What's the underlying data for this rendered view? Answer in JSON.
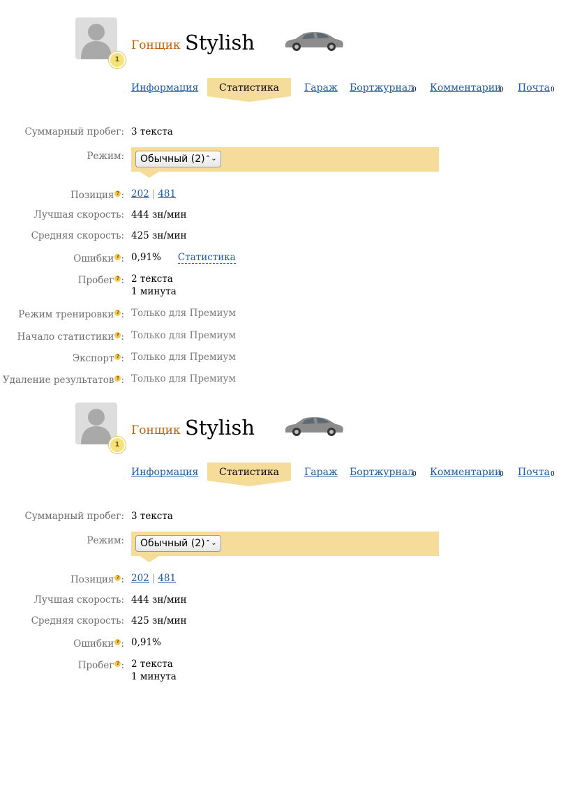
{
  "profile": {
    "rank": "Гонщик",
    "nickname": "Stylish",
    "level": "1"
  },
  "tabs": {
    "info": "Информация",
    "stats": "Статистика",
    "garage": "Гараж",
    "journal": "Бортжурнал",
    "journal_count": "0",
    "comments": "Комментарии",
    "comments_count": "0",
    "mail": "Почта",
    "mail_count": "0"
  },
  "stats": {
    "total_label": "Суммарный пробег:",
    "total_value": "3 текста",
    "mode_label": "Режим:",
    "mode_selected": "Обычный (2)",
    "position_label": "Позиция",
    "position_a": "202",
    "position_sep": "|",
    "position_b": "481",
    "best_label": "Лучшая скорость:",
    "best_value": "444 зн/мин",
    "avg_label": "Средняя скорость:",
    "avg_value": "425 зн/мин",
    "errors_label": "Ошибки",
    "errors_value": "0,91%",
    "errors_link": "Статистика",
    "mileage_label": "Пробег",
    "mileage_texts": "2 текста",
    "mileage_time": "1 минута",
    "training_label": "Режим тренировки",
    "start_label": "Начало статистики",
    "export_label": "Экспорт",
    "delete_label": "Удаление результатов",
    "premium_only": "Только для Премиум",
    "help_mark": "?",
    "colon": ":"
  },
  "colors": {
    "accent_bar": "#f5dc9a",
    "link": "#1e5aa0",
    "rank": "#c0620a"
  }
}
